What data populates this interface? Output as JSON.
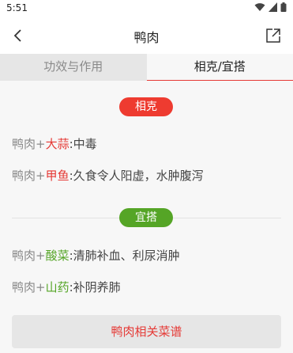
{
  "status_bar": {
    "time": "5:51"
  },
  "app_bar": {
    "title": "鸭肉"
  },
  "tabs": [
    {
      "label": "功效与作用",
      "active": false
    },
    {
      "label": "相克/宜搭",
      "active": true
    }
  ],
  "conflict": {
    "badge": "相克",
    "items": [
      {
        "base": "鸭肉",
        "plus": "+",
        "food": "大蒜",
        "colon": ":",
        "effect": "中毒"
      },
      {
        "base": "鸭肉",
        "plus": "+",
        "food": "甲鱼",
        "colon": ":",
        "effect": "久食令人阳虚，水肿腹泻"
      }
    ]
  },
  "suitable": {
    "badge": "宜搭",
    "items": [
      {
        "base": "鸭肉",
        "plus": "+",
        "food": "酸菜",
        "colon": ":",
        "effect": "清肺补血、利尿消肿"
      },
      {
        "base": "鸭肉",
        "plus": "+",
        "food": "山药",
        "colon": ":",
        "effect": "补阴养肺"
      }
    ]
  },
  "bottom_button": {
    "label": "鸭肉相关菜谱"
  },
  "colors": {
    "accent_red": "#e53935",
    "badge_red": "#ee3b30",
    "badge_green": "#55a526"
  }
}
